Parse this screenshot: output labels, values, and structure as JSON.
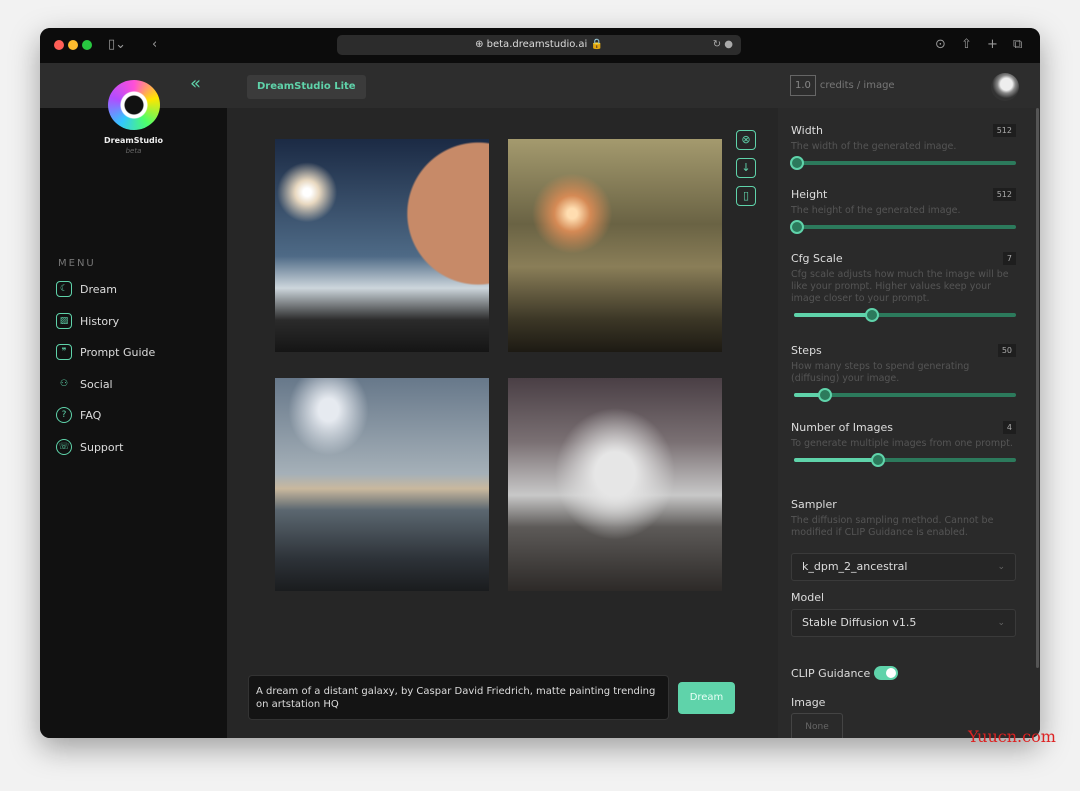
{
  "browser": {
    "url": "beta.dreamstudio.ai"
  },
  "header": {
    "product_pill": "DreamStudio Lite",
    "credits_value": "1.0",
    "credits_label": "credits / image"
  },
  "sidebar": {
    "brand": "DreamStudio",
    "beta": "beta",
    "menu_heading": "MENU",
    "items": [
      {
        "label": "Dream",
        "icon": "moon-sparkle-icon"
      },
      {
        "label": "History",
        "icon": "image-gallery-icon"
      },
      {
        "label": "Prompt Guide",
        "icon": "quote-bubble-icon"
      },
      {
        "label": "Social",
        "icon": "users-icon"
      },
      {
        "label": "FAQ",
        "icon": "question-icon"
      },
      {
        "label": "Support",
        "icon": "support-icon"
      }
    ]
  },
  "prompt": {
    "text": "A dream of a distant galaxy, by Caspar David Friedrich, matte painting trending on artstation HQ",
    "button": "Dream"
  },
  "settings": {
    "width": {
      "label": "Width",
      "value": "512",
      "desc": "The width of the generated image.",
      "fraction": 0
    },
    "height": {
      "label": "Height",
      "value": "512",
      "desc": "The height of the generated image.",
      "fraction": 0
    },
    "cfg": {
      "label": "Cfg Scale",
      "value": "7",
      "desc": "Cfg scale adjusts how much the image will be like your prompt. Higher values keep your image closer to your prompt.",
      "fraction": 0.35
    },
    "steps": {
      "label": "Steps",
      "value": "50",
      "desc": "How many steps to spend generating (diffusing) your image.",
      "fraction": 0.13
    },
    "num_images": {
      "label": "Number of Images",
      "value": "4",
      "desc": "To generate multiple images from one prompt.",
      "fraction": 0.38
    },
    "sampler": {
      "label": "Sampler",
      "desc": "The diffusion sampling method. Cannot be modified if CLIP Guidance is enabled.",
      "value": "k_dpm_2_ancestral"
    },
    "model": {
      "label": "Model",
      "value": "Stable Diffusion v1.5"
    },
    "clip": {
      "label": "CLIP Guidance",
      "enabled": true
    },
    "image": {
      "label": "Image",
      "value": "None"
    }
  },
  "accent": "#5fd3aa",
  "watermark": "Yuucn.com"
}
